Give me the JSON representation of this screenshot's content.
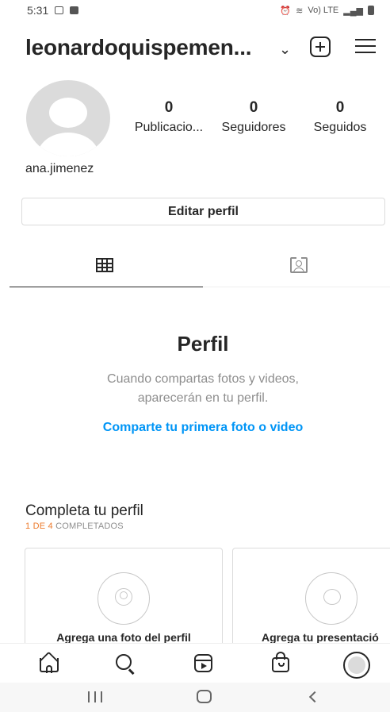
{
  "status_bar": {
    "time": "5:31",
    "left_icons": [
      "image-icon",
      "notification-icon"
    ],
    "right_icons": [
      "alarm-icon",
      "wifi-icon",
      "volte-lte-icon",
      "signal-icon",
      "battery-icon"
    ],
    "network_label": "Vo) LTE"
  },
  "header": {
    "username": "leonardoquispemen...",
    "icons": [
      "chevron-down-icon",
      "plus-square-icon",
      "hamburger-menu-icon"
    ]
  },
  "profile": {
    "handle": "ana.jimenez",
    "stats": [
      {
        "value": "0",
        "label": "Publicacio..."
      },
      {
        "value": "0",
        "label": "Seguidores"
      },
      {
        "value": "0",
        "label": "Seguidos"
      }
    ],
    "edit_button_label": "Editar perfil"
  },
  "tabs": [
    {
      "icon": "grid-icon",
      "active": true
    },
    {
      "icon": "tagged-person-icon",
      "active": false
    }
  ],
  "empty_state": {
    "title": "Perfil",
    "description": "Cuando compartas fotos y videos, aparecerán en tu perfil.",
    "link_label": "Comparte tu primera foto o video"
  },
  "complete_profile": {
    "title": "Completa tu perfil",
    "progress_label": "1 DE 4",
    "progress_suffix": " COMPLETADOS",
    "progress_fraction": 0.25,
    "accent_color": "#ed7a2b",
    "cards": [
      {
        "title": "Agrega una foto del perfil",
        "icon": "profile-photo-icon"
      },
      {
        "title": "Agrega tu presentació",
        "icon": "speech-bubble-icon"
      }
    ]
  },
  "bottom_nav": {
    "items": [
      "home-icon",
      "search-icon",
      "reels-icon",
      "shop-icon",
      "profile-avatar-icon"
    ]
  },
  "android_nav": {
    "items": [
      "recents-icon",
      "home-button-icon",
      "back-icon"
    ]
  },
  "colors": {
    "text": "#262626",
    "secondary_text": "#8e8e8e",
    "link": "#0095f6",
    "border": "#dbdbdb",
    "avatar_placeholder": "#dbdbdb"
  }
}
